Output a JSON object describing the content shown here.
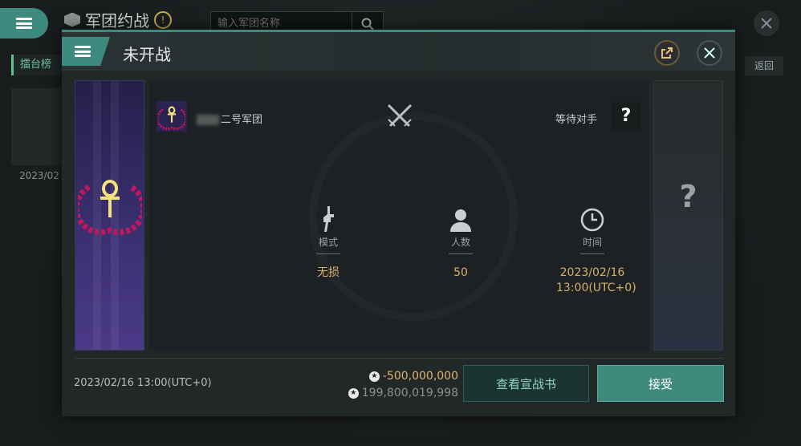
{
  "background": {
    "title": "军团约战",
    "search_placeholder": "输入军团名称",
    "tab_label": "擂台榜",
    "back_label": "返回",
    "item_date": "2023/02"
  },
  "modal": {
    "title": "未开战",
    "our_legion": "二号军团",
    "opponent_status": "等待对手",
    "opponent_placeholder": "?",
    "info": {
      "mode_label": "模式",
      "mode_value": "无损",
      "count_label": "人数",
      "count_value": "50",
      "time_label": "时间",
      "time_value_date": "2023/02/16",
      "time_value_time": "13:00(UTC+0)"
    },
    "footer": {
      "datetime": "2023/02/16 13:00(UTC+0)",
      "cost": "-500,000,000",
      "balance": "199,800,019,998",
      "view_button": "查看宣战书",
      "accept_button": "接受"
    }
  },
  "colors": {
    "accent": "#3e8a7d",
    "gold": "#d6b16a",
    "banner_purple": "#3b2f70",
    "laurel_red": "#c2185b"
  }
}
